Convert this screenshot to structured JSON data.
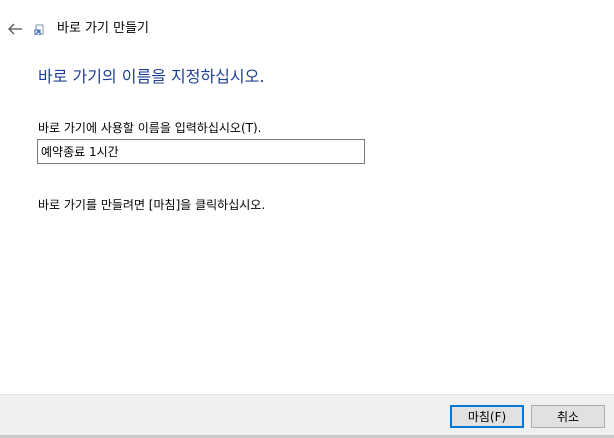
{
  "header": {
    "back_icon": "arrow-left-icon",
    "wizard_icon": "shortcut-wizard-icon",
    "title": "바로 가기 만들기"
  },
  "page": {
    "heading": "바로 가기의 이름을 지정하십시오.",
    "heading_color": "#1e3f96",
    "name_label": "바로 가기에 사용할 이름을 입력하십시오(T).",
    "name_value": "예약종료 1시간",
    "finish_hint": "바로 가기를 만들려면 [마침]을 클릭하십시오."
  },
  "footer": {
    "finish_label": "마침(F)",
    "cancel_label": "취소",
    "focus_color": "#0078d7"
  }
}
